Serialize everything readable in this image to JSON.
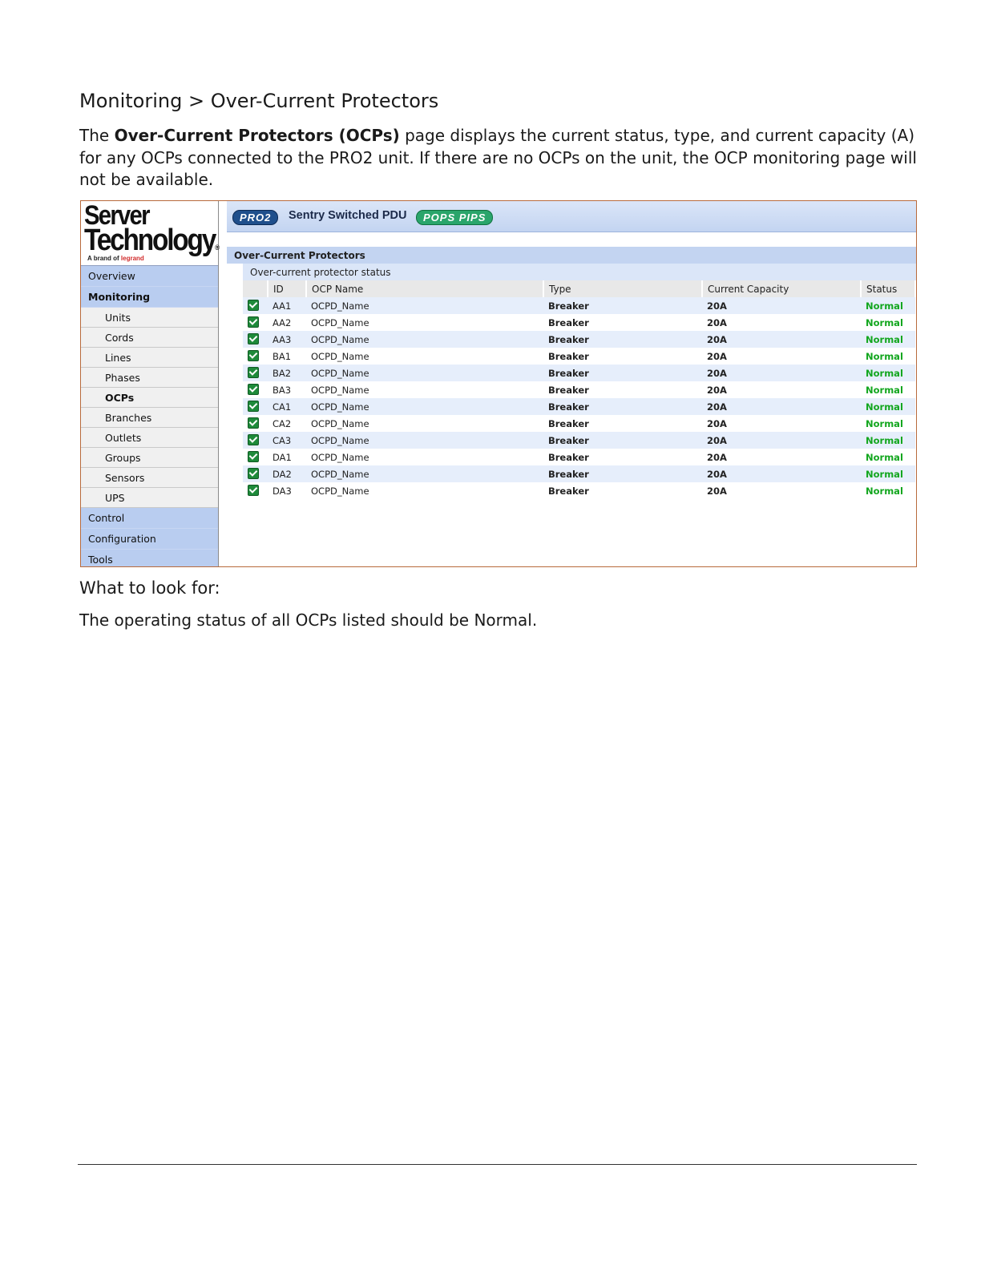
{
  "doc": {
    "heading": "Monitoring > Over-Current Protectors",
    "intro_pre": "The ",
    "intro_strong": "Over-Current Protectors (OCPs)",
    "intro_post": " page displays the current status, type, and current capacity (A) for any OCPs connected to the PRO2 unit. If there are no OCPs on the unit, the OCP monitoring page will not be available.",
    "look_for_heading": "What to look for:",
    "look_for_text": "The operating status of all OCPs listed should be Normal."
  },
  "logo": {
    "line1": "Server",
    "line2": "Technology",
    "mark": "®",
    "tagline_pre": "A brand of ",
    "tagline_brand": "legrand"
  },
  "banner": {
    "badge_left": "PRO2",
    "product": "Sentry Switched PDU",
    "badge_right": "POPS PIPS"
  },
  "sidebar": {
    "top": [
      {
        "label": "Overview",
        "active": false
      },
      {
        "label": "Monitoring",
        "active": true
      }
    ],
    "sub": [
      {
        "label": "Units",
        "active": false
      },
      {
        "label": "Cords",
        "active": false
      },
      {
        "label": "Lines",
        "active": false
      },
      {
        "label": "Phases",
        "active": false
      },
      {
        "label": "OCPs",
        "active": true
      },
      {
        "label": "Branches",
        "active": false
      },
      {
        "label": "Outlets",
        "active": false
      },
      {
        "label": "Groups",
        "active": false
      },
      {
        "label": "Sensors",
        "active": false
      },
      {
        "label": "UPS",
        "active": false
      }
    ],
    "bottom": [
      {
        "label": "Control"
      },
      {
        "label": "Configuration"
      },
      {
        "label": "Tools"
      }
    ]
  },
  "main": {
    "section_title": "Over-Current Protectors",
    "subsection_title": "Over-current protector status",
    "columns": [
      "ID",
      "OCP Name",
      "Type",
      "Current Capacity",
      "Status"
    ],
    "rows": [
      {
        "id": "AA1",
        "name": "OCPD_Name",
        "type": "Breaker",
        "capacity": "20A",
        "status": "Normal"
      },
      {
        "id": "AA2",
        "name": "OCPD_Name",
        "type": "Breaker",
        "capacity": "20A",
        "status": "Normal"
      },
      {
        "id": "AA3",
        "name": "OCPD_Name",
        "type": "Breaker",
        "capacity": "20A",
        "status": "Normal"
      },
      {
        "id": "BA1",
        "name": "OCPD_Name",
        "type": "Breaker",
        "capacity": "20A",
        "status": "Normal"
      },
      {
        "id": "BA2",
        "name": "OCPD_Name",
        "type": "Breaker",
        "capacity": "20A",
        "status": "Normal"
      },
      {
        "id": "BA3",
        "name": "OCPD_Name",
        "type": "Breaker",
        "capacity": "20A",
        "status": "Normal"
      },
      {
        "id": "CA1",
        "name": "OCPD_Name",
        "type": "Breaker",
        "capacity": "20A",
        "status": "Normal"
      },
      {
        "id": "CA2",
        "name": "OCPD_Name",
        "type": "Breaker",
        "capacity": "20A",
        "status": "Normal"
      },
      {
        "id": "CA3",
        "name": "OCPD_Name",
        "type": "Breaker",
        "capacity": "20A",
        "status": "Normal"
      },
      {
        "id": "DA1",
        "name": "OCPD_Name",
        "type": "Breaker",
        "capacity": "20A",
        "status": "Normal"
      },
      {
        "id": "DA2",
        "name": "OCPD_Name",
        "type": "Breaker",
        "capacity": "20A",
        "status": "Normal"
      },
      {
        "id": "DA3",
        "name": "OCPD_Name",
        "type": "Breaker",
        "capacity": "20A",
        "status": "Normal"
      }
    ]
  },
  "colors": {
    "frame_border": "#b86a3c",
    "nav_blue": "#b9cdf0",
    "status_normal": "#12a61e",
    "check_green": "#1e8a3a"
  }
}
